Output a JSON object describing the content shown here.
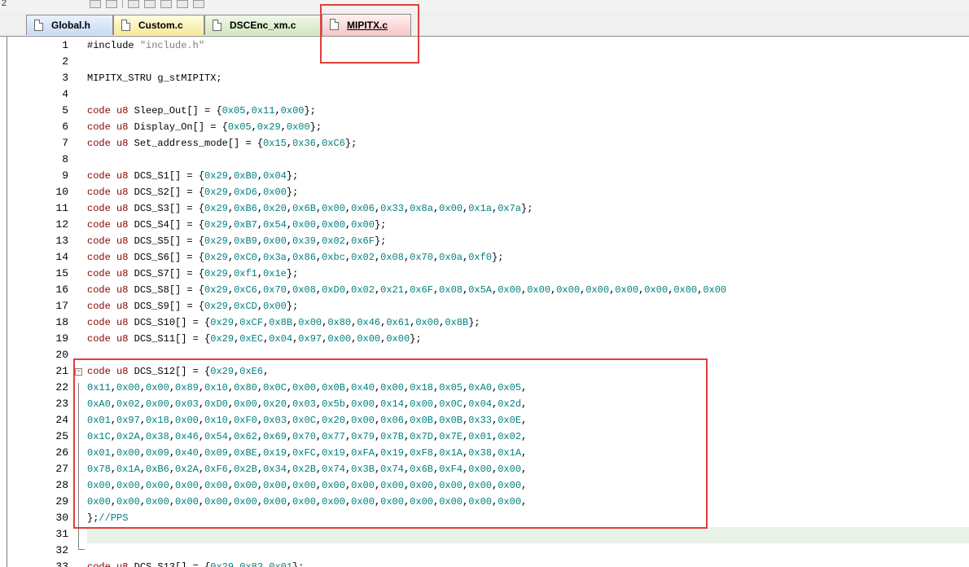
{
  "toolbar": {
    "left_text": "2"
  },
  "tabs": [
    {
      "label": "Global.h",
      "color": "#c7daf3",
      "active": false
    },
    {
      "label": "Custom.c",
      "color": "#f6e89a",
      "active": false
    },
    {
      "label": "DSCEnc_xm.c",
      "color": "#d2e6bf",
      "active": false
    },
    {
      "label": "MIPITX.c",
      "color": "#f7c5c5",
      "active": true
    }
  ],
  "colors": {
    "keyword": "#8b0000",
    "hex_literal": "#008080",
    "string": "#808080",
    "highlight_box": "#e0403c",
    "current_line": "#e8f2e8"
  },
  "editor": {
    "current_line": 31,
    "fold_marker_line": 21,
    "lines": [
      {
        "n": "1",
        "text": "#include \"include.h\""
      },
      {
        "n": "2",
        "text": ""
      },
      {
        "n": "3",
        "text": "MIPITX_STRU g_stMIPITX;"
      },
      {
        "n": "4",
        "text": ""
      },
      {
        "n": "5",
        "text": "code u8 Sleep_Out[] = {0x05,0x11,0x00};"
      },
      {
        "n": "6",
        "text": "code u8 Display_On[] = {0x05,0x29,0x00};"
      },
      {
        "n": "7",
        "text": "code u8 Set_address_mode[] = {0x15,0x36,0xC6};"
      },
      {
        "n": "8",
        "text": ""
      },
      {
        "n": "9",
        "text": "code u8 DCS_S1[] = {0x29,0xB0,0x04};"
      },
      {
        "n": "10",
        "text": "code u8 DCS_S2[] = {0x29,0xD6,0x00};"
      },
      {
        "n": "11",
        "text": "code u8 DCS_S3[] = {0x29,0xB6,0x20,0x6B,0x00,0x06,0x33,0x8a,0x00,0x1a,0x7a};"
      },
      {
        "n": "12",
        "text": "code u8 DCS_S4[] = {0x29,0xB7,0x54,0x00,0x00,0x00};"
      },
      {
        "n": "13",
        "text": "code u8 DCS_S5[] = {0x29,0xB9,0x00,0x39,0x02,0x6F};"
      },
      {
        "n": "14",
        "text": "code u8 DCS_S6[] = {0x29,0xC0,0x3a,0x86,0xbc,0x02,0x08,0x70,0x0a,0xf0};"
      },
      {
        "n": "15",
        "text": "code u8 DCS_S7[] = {0x29,0xf1,0x1e};"
      },
      {
        "n": "16",
        "text": "code u8 DCS_S8[] = {0x29,0xC6,0x70,0x08,0xD0,0x02,0x21,0x6F,0x08,0x5A,0x00,0x00,0x00,0x00,0x00,0x00,0x00,0x00"
      },
      {
        "n": "17",
        "text": "code u8 DCS_S9[] = {0x29,0xCD,0x00};"
      },
      {
        "n": "18",
        "text": "code u8 DCS_S10[] = {0x29,0xCF,0x8B,0x00,0x80,0x46,0x61,0x00,0x8B};"
      },
      {
        "n": "19",
        "text": "code u8 DCS_S11[] = {0x29,0xEC,0x04,0x97,0x00,0x00,0x00};"
      },
      {
        "n": "20",
        "text": ""
      },
      {
        "n": "21",
        "text": "code u8 DCS_S12[] = {0x29,0xE6,"
      },
      {
        "n": "22",
        "text": "0x11,0x00,0x00,0x89,0x10,0x80,0x0C,0x00,0x0B,0x40,0x00,0x18,0x05,0xA0,0x05,"
      },
      {
        "n": "23",
        "text": "0xA0,0x02,0x00,0x03,0xD0,0x00,0x20,0x03,0x5b,0x00,0x14,0x00,0x0C,0x04,0x2d,"
      },
      {
        "n": "24",
        "text": "0x01,0x97,0x18,0x00,0x10,0xF0,0x03,0x0C,0x20,0x00,0x06,0x0B,0x0B,0x33,0x0E,"
      },
      {
        "n": "25",
        "text": "0x1C,0x2A,0x38,0x46,0x54,0x62,0x69,0x70,0x77,0x79,0x7B,0x7D,0x7E,0x01,0x02,"
      },
      {
        "n": "26",
        "text": "0x01,0x00,0x09,0x40,0x09,0xBE,0x19,0xFC,0x19,0xFA,0x19,0xF8,0x1A,0x38,0x1A,"
      },
      {
        "n": "27",
        "text": "0x78,0x1A,0xB6,0x2A,0xF6,0x2B,0x34,0x2B,0x74,0x3B,0x74,0x6B,0xF4,0x00,0x00,"
      },
      {
        "n": "28",
        "text": "0x00,0x00,0x00,0x00,0x00,0x00,0x00,0x00,0x00,0x00,0x00,0x00,0x00,0x00,0x00,"
      },
      {
        "n": "29",
        "text": "0x00,0x00,0x00,0x00,0x00,0x00,0x00,0x00,0x00,0x00,0x00,0x00,0x00,0x00,0x00,"
      },
      {
        "n": "30",
        "text": "};//PPS"
      },
      {
        "n": "31",
        "text": ""
      },
      {
        "n": "32",
        "text": ""
      },
      {
        "n": "33",
        "text": "code u8 DCS_S13[] = {0x29,0x83,0x01};"
      }
    ]
  }
}
